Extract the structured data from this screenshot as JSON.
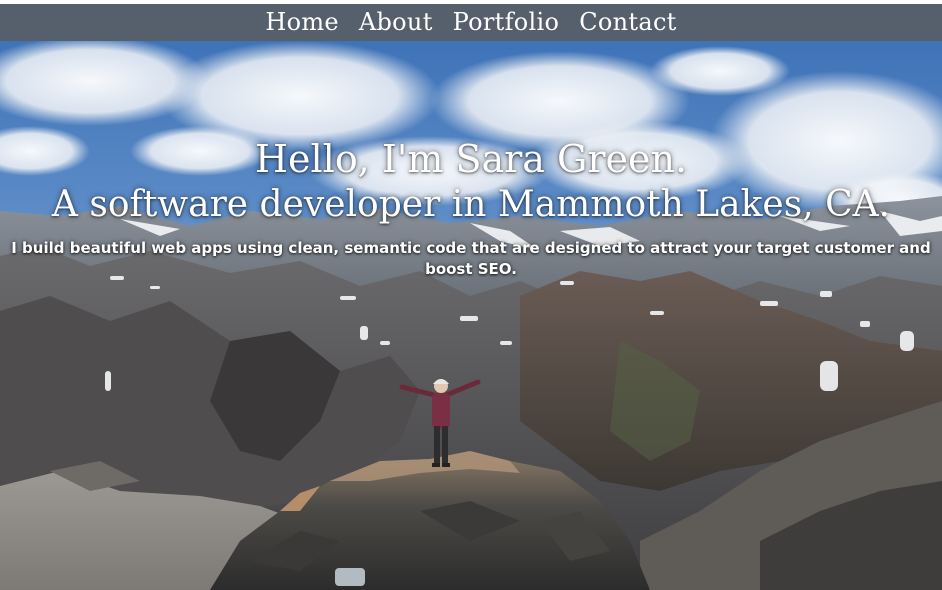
{
  "nav": {
    "items": [
      {
        "label": "Home"
      },
      {
        "label": "About"
      },
      {
        "label": "Portfolio"
      },
      {
        "label": "Contact"
      }
    ]
  },
  "hero": {
    "headline_line1": "Hello, I'm Sara Green.",
    "headline_line2": "A software developer in Mammoth Lakes, CA.",
    "tagline": "I build beautiful web apps using clean, semantic code that are designed to attract your target customer and boost SEO."
  },
  "colors": {
    "nav_background": "#56606d",
    "text": "#ffffff"
  }
}
